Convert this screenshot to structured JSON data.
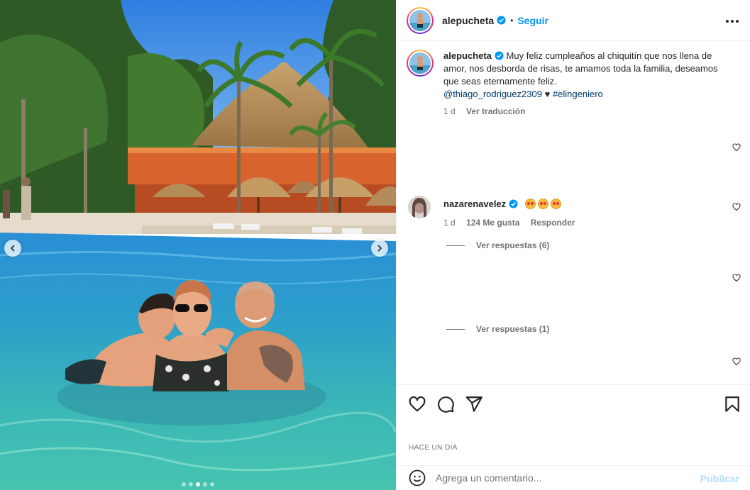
{
  "post": {
    "username": "alepucheta",
    "follow_label": "Seguir",
    "separator": "•",
    "caption": "Muy feliz cumpleaños al chiquitín que nos llena de amor, nos desborda de risas, te amamos toda la familia, deseamos que seas eternamente feliz.",
    "mention": "@thiago_rodriguez2309",
    "heart_symbol": "♥",
    "hashtag": "#elingeniero",
    "age": "1 d",
    "translate_label": "Ver traducción",
    "timestamp": "HACE UN DIA",
    "carousel": {
      "count": 5,
      "active_index": 2
    }
  },
  "comments": [
    {
      "username": "nazarenavelez",
      "emoji_count": 3,
      "age": "1 d",
      "likes": "124 Me gusta",
      "reply_label": "Responder"
    }
  ],
  "reply_threads": [
    {
      "label": "Ver respuestas (6)"
    },
    {
      "label": "Ver respuestas (1)"
    }
  ],
  "comment_input": {
    "placeholder": "Agrega un comentario...",
    "publish_label": "Publicar"
  },
  "icons": {
    "more": "more-options-icon",
    "like": "heart-icon",
    "comment": "comment-icon",
    "share": "send-icon",
    "save": "bookmark-icon",
    "emoji": "emoji-icon",
    "verified": "verified-badge-icon"
  },
  "colors": {
    "accent": "#0095f6",
    "link": "#00376b",
    "muted": "#737373",
    "publish_disabled": "#b2dffc"
  }
}
